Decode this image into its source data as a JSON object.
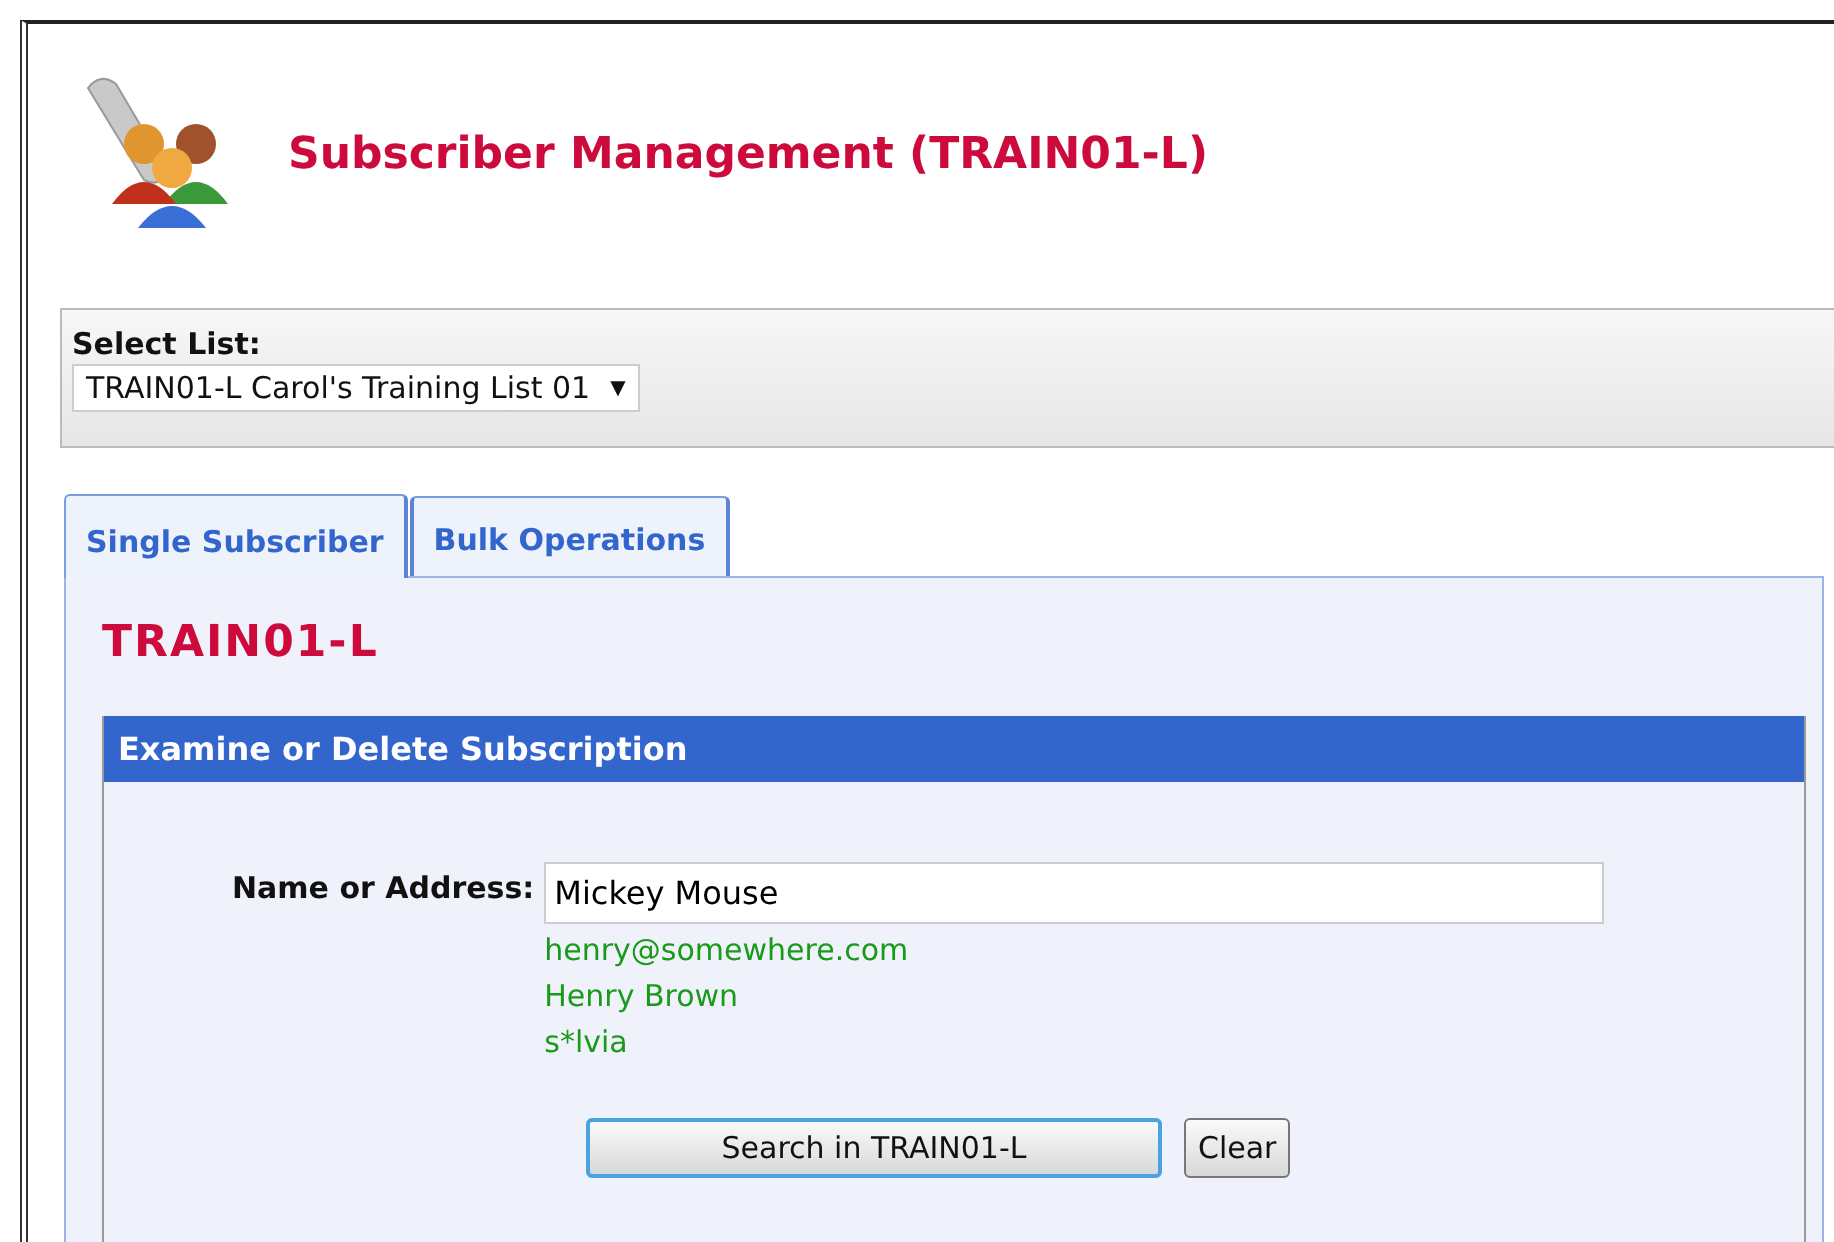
{
  "header": {
    "title": "Subscriber Management (TRAIN01-L)"
  },
  "list_selector": {
    "label": "Select List:",
    "value": "TRAIN01-L Carol's Training List 01",
    "caret": "▼"
  },
  "tabs": [
    {
      "label": "Single Subscriber",
      "selected": true
    },
    {
      "label": "Bulk Operations",
      "selected": false
    }
  ],
  "list_name": "TRAIN01-L",
  "section": {
    "title": "Examine or Delete Subscription",
    "field": {
      "label": "Name or Address:",
      "value": "Mickey Mouse"
    },
    "hints": [
      "henry@somewhere.com",
      "Henry Brown",
      "s*lvia"
    ],
    "buttons": [
      "Search in TRAIN01-L",
      "Clear"
    ]
  }
}
